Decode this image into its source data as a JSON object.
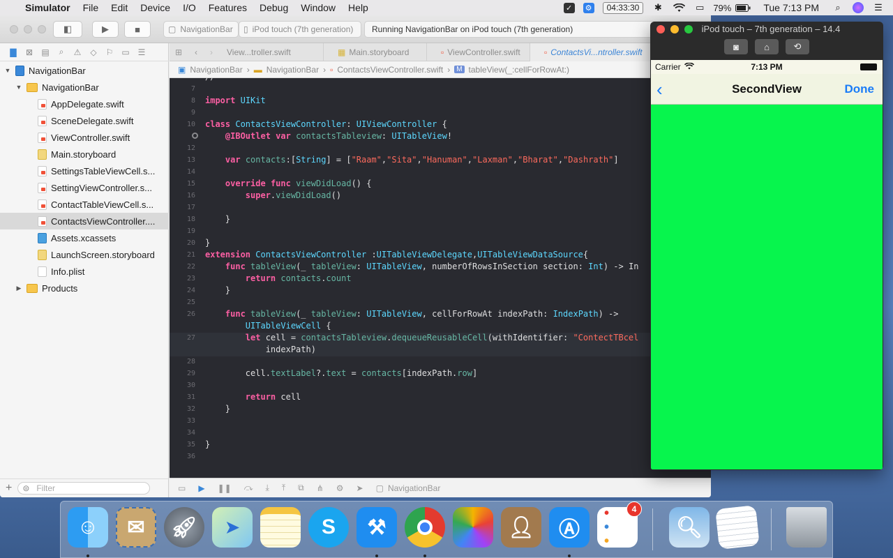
{
  "menubar": {
    "app_name": "Simulator",
    "items": [
      "File",
      "Edit",
      "Device",
      "I/O",
      "Features",
      "Debug",
      "Window",
      "Help"
    ],
    "clock_timer": "04:33:30",
    "battery": "79%",
    "datetime": "Tue 7:13 PM"
  },
  "toolbar": {
    "scheme": "NavigationBar",
    "destination": "iPod touch (7th generation)",
    "activity": "Running NavigationBar on iPod touch (7th generation)"
  },
  "navigator": {
    "filter_placeholder": "Filter",
    "items": [
      {
        "label": "NavigationBar",
        "level": 0,
        "icon": "project-icon",
        "expanded": true
      },
      {
        "label": "NavigationBar",
        "level": 1,
        "icon": "folder-icon",
        "expanded": true
      },
      {
        "label": "AppDelegate.swift",
        "level": 2,
        "icon": "swift-file-icon"
      },
      {
        "label": "SceneDelegate.swift",
        "level": 2,
        "icon": "swift-file-icon"
      },
      {
        "label": "ViewController.swift",
        "level": 2,
        "icon": "swift-file-icon"
      },
      {
        "label": "Main.storyboard",
        "level": 2,
        "icon": "storyboard-icon"
      },
      {
        "label": "SettingsTableViewCell.s...",
        "level": 2,
        "icon": "swift-file-icon"
      },
      {
        "label": "SettingViewController.s...",
        "level": 2,
        "icon": "swift-file-icon"
      },
      {
        "label": "ContactTableViewCell.s...",
        "level": 2,
        "icon": "swift-file-icon"
      },
      {
        "label": "ContactsViewController....",
        "level": 2,
        "icon": "swift-file-icon",
        "selected": true
      },
      {
        "label": "Assets.xcassets",
        "level": 2,
        "icon": "assets-icon"
      },
      {
        "label": "LaunchScreen.storyboard",
        "level": 2,
        "icon": "storyboard-icon"
      },
      {
        "label": "Info.plist",
        "level": 2,
        "icon": "plist-icon"
      },
      {
        "label": "Products",
        "level": 1,
        "icon": "folder-icon",
        "expanded": false
      }
    ]
  },
  "tabs": [
    "View...troller.swift",
    "Main.storyboard",
    "ViewController.swift",
    "ContactsVi...ntroller.swift"
  ],
  "jumpbar": [
    "NavigationBar",
    "NavigationBar",
    "ContactsViewController.swift",
    "tableView(_:cellForRowAt:)"
  ],
  "code": {
    "current_line": 27,
    "lines": [
      {
        "n": "",
        "text": "//"
      },
      {
        "n": "7",
        "text": ""
      },
      {
        "n": "8",
        "text": "import UIKit"
      },
      {
        "n": "9",
        "text": ""
      },
      {
        "n": "10",
        "text": "class ContactsViewController: UIViewController {"
      },
      {
        "n": "",
        "text": "    @IBOutlet var contactsTableview: UITableView!"
      },
      {
        "n": "12",
        "text": ""
      },
      {
        "n": "13",
        "text": "    var contacts:[String] = [\"Raam\",\"Sita\",\"Hanuman\",\"Laxman\",\"Bharat\",\"Dashrath\"]"
      },
      {
        "n": "14",
        "text": ""
      },
      {
        "n": "15",
        "text": "    override func viewDidLoad() {"
      },
      {
        "n": "16",
        "text": "        super.viewDidLoad()"
      },
      {
        "n": "17",
        "text": ""
      },
      {
        "n": "18",
        "text": "    }"
      },
      {
        "n": "19",
        "text": ""
      },
      {
        "n": "20",
        "text": "}"
      },
      {
        "n": "21",
        "text": "extension ContactsViewController :UITableViewDelegate,UITableViewDataSource{"
      },
      {
        "n": "22",
        "text": "    func tableView(_ tableView: UITableView, numberOfRowsInSection section: Int) -> In"
      },
      {
        "n": "23",
        "text": "        return contacts.count"
      },
      {
        "n": "24",
        "text": "    }"
      },
      {
        "n": "25",
        "text": ""
      },
      {
        "n": "26",
        "text": "    func tableView(_ tableView: UITableView, cellForRowAt indexPath: IndexPath) ->"
      },
      {
        "n": "",
        "text": "        UITableViewCell {"
      },
      {
        "n": "27",
        "text": "        let cell = contactsTableview.dequeueReusableCell(withIdentifier: \"ContectTBcel"
      },
      {
        "n": "",
        "text": "            indexPath)"
      },
      {
        "n": "28",
        "text": ""
      },
      {
        "n": "29",
        "text": "        cell.textLabel?.text = contacts[indexPath.row]"
      },
      {
        "n": "30",
        "text": ""
      },
      {
        "n": "31",
        "text": "        return cell"
      },
      {
        "n": "32",
        "text": "    }"
      },
      {
        "n": "33",
        "text": ""
      },
      {
        "n": "34",
        "text": ""
      },
      {
        "n": "35",
        "text": "}"
      },
      {
        "n": "36",
        "text": ""
      }
    ]
  },
  "debugbar": {
    "target": "NavigationBar"
  },
  "simulator": {
    "title": "iPod touch – 7th generation – 14.4",
    "carrier": "Carrier",
    "time": "7:13 PM",
    "nav_title": "SecondView",
    "done_label": "Done",
    "screen_color": "#07f54d"
  },
  "dock": {
    "reminders_badge": "4",
    "apps": [
      "finder",
      "mail",
      "launchpad",
      "maps",
      "notes",
      "skype",
      "xcode",
      "chrome",
      "photos",
      "contacts",
      "app-store",
      "reminders",
      "preview",
      "textedit",
      "trash"
    ]
  }
}
